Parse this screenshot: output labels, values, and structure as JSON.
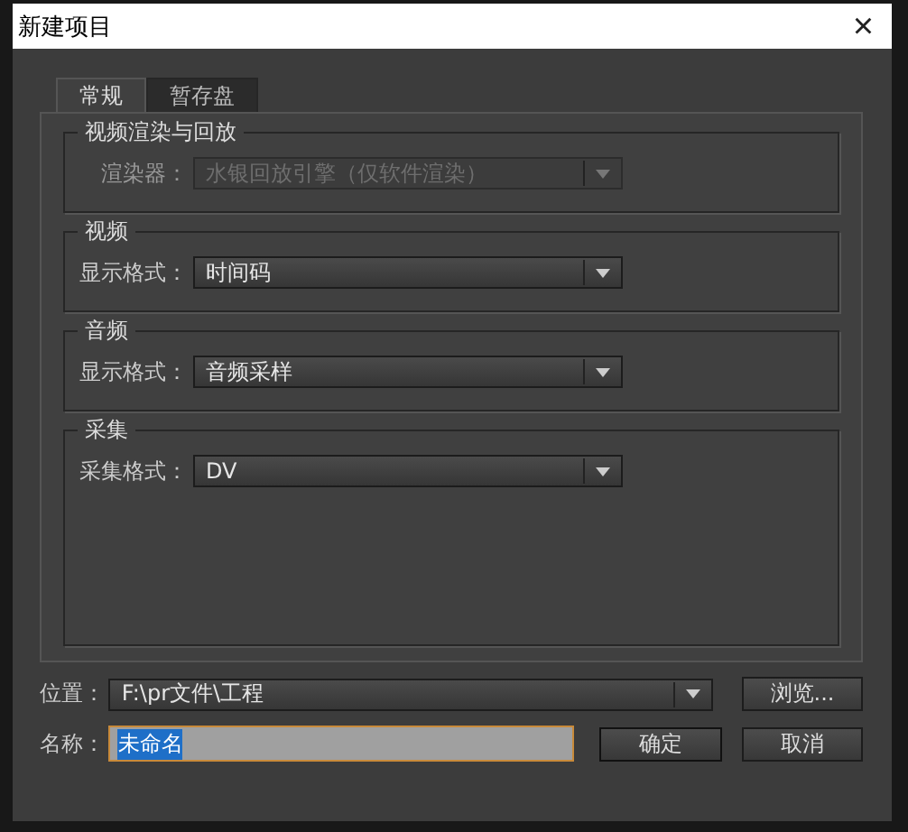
{
  "window": {
    "title": "新建项目",
    "close": "×"
  },
  "tabs": [
    {
      "label": "常规",
      "selected": true
    },
    {
      "label": "暂存盘",
      "selected": false
    }
  ],
  "groups": [
    {
      "title": "视频渲染与回放",
      "rows": [
        {
          "label": "渲染器：",
          "value": "水银回放引擎（仅软件渲染）",
          "disabled": true
        }
      ]
    },
    {
      "title": "视频",
      "rows": [
        {
          "label": "显示格式：",
          "value": "时间码",
          "disabled": false
        }
      ]
    },
    {
      "title": "音频",
      "rows": [
        {
          "label": "显示格式：",
          "value": "音频采样",
          "disabled": false
        }
      ]
    },
    {
      "title": "采集",
      "rows": [
        {
          "label": "采集格式：",
          "value": "DV",
          "disabled": false
        }
      ]
    }
  ],
  "location": {
    "label": "位置：",
    "value": "F:\\pr文件\\工程",
    "browse": "浏览..."
  },
  "name": {
    "label": "名称：",
    "value": "未命名",
    "text_selected": true
  },
  "buttons": [
    "确定",
    "取消"
  ]
}
